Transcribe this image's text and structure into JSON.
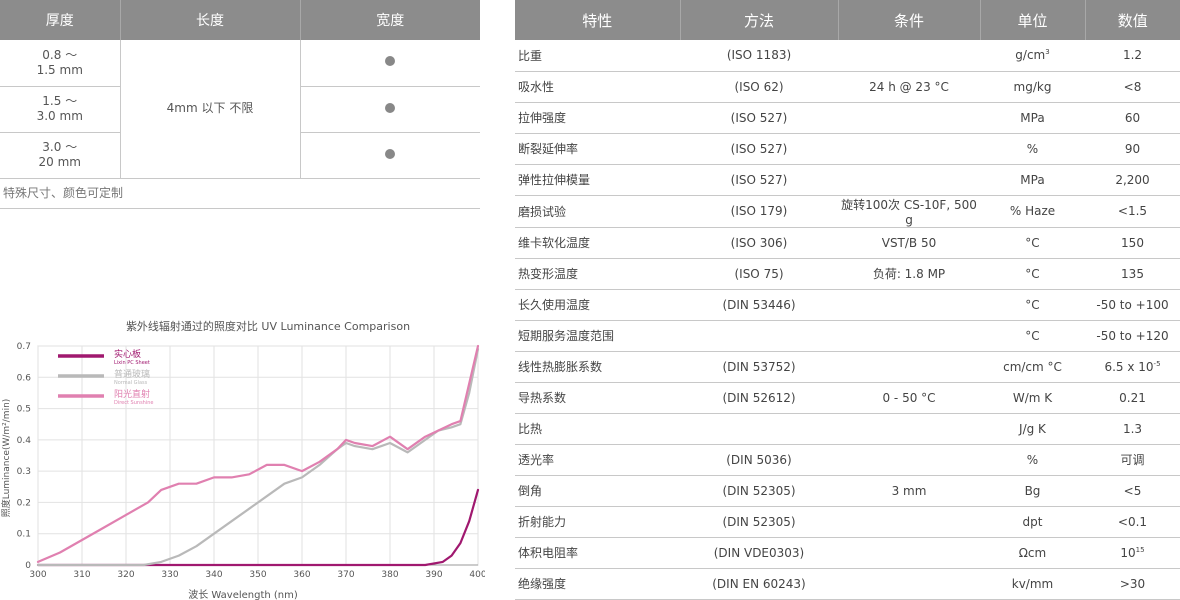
{
  "size_table": {
    "headers": [
      "厚度",
      "长度",
      "宽度"
    ],
    "rows": [
      {
        "thickness_1": "0.8 ～",
        "thickness_2": "1.5 mm"
      },
      {
        "thickness_1": "1.5 ～",
        "thickness_2": "3.0 mm"
      },
      {
        "thickness_1": "3.0 ～",
        "thickness_2": "20 mm"
      }
    ],
    "length_value": "4mm 以下 不限",
    "note": "特殊尺寸、颜色可定制"
  },
  "chart_data": {
    "type": "line",
    "title": "紫外线辐射通过的照度对比 UV Luminance Comparison",
    "xlabel": "波长 Wavelength (nm)",
    "ylabel": "照度Luminance(W/m²/min)",
    "xlim": [
      300,
      400
    ],
    "ylim": [
      0,
      0.7
    ],
    "x_ticks": [
      "300",
      "310",
      "320",
      "330",
      "340",
      "350",
      "360",
      "370",
      "380",
      "390",
      "400"
    ],
    "y_ticks": [
      "0",
      "0.1",
      "0.2",
      "0.3",
      "0.4",
      "0.5",
      "0.6",
      "0.7"
    ],
    "grid": true,
    "legend_placement": "top-left",
    "series": [
      {
        "name": "实心板",
        "sub": "Lixin PC Sheet",
        "color": "#a0186f",
        "x": [
          300,
          350,
          388,
          392,
          394,
          396,
          398,
          400
        ],
        "y": [
          0,
          0,
          0,
          0.01,
          0.03,
          0.07,
          0.14,
          0.24
        ]
      },
      {
        "name": "普通玻璃",
        "sub": "Normal Glass",
        "color": "#b9b9b9",
        "x": [
          300,
          324,
          328,
          332,
          336,
          340,
          344,
          348,
          352,
          356,
          360,
          364,
          368,
          370,
          372,
          376,
          380,
          384,
          388,
          391,
          394,
          396,
          398,
          400
        ],
        "y": [
          0,
          0,
          0.01,
          0.03,
          0.06,
          0.1,
          0.14,
          0.18,
          0.22,
          0.26,
          0.28,
          0.32,
          0.37,
          0.39,
          0.38,
          0.37,
          0.39,
          0.36,
          0.4,
          0.43,
          0.44,
          0.45,
          0.55,
          0.69
        ]
      },
      {
        "name": "阳光直射",
        "sub": "Direct Sunshine",
        "color": "#e080b0",
        "x": [
          300,
          305,
          310,
          315,
          320,
          325,
          328,
          332,
          336,
          340,
          344,
          348,
          352,
          356,
          360,
          364,
          368,
          370,
          372,
          376,
          380,
          384,
          388,
          391,
          394,
          396,
          398,
          400
        ],
        "y": [
          0.01,
          0.04,
          0.08,
          0.12,
          0.16,
          0.2,
          0.24,
          0.26,
          0.26,
          0.28,
          0.28,
          0.29,
          0.32,
          0.32,
          0.3,
          0.33,
          0.37,
          0.4,
          0.39,
          0.38,
          0.41,
          0.37,
          0.41,
          0.43,
          0.45,
          0.46,
          0.58,
          0.7
        ]
      }
    ]
  },
  "prop_table": {
    "headers": [
      "特性",
      "方法",
      "条件",
      "单位",
      "数值"
    ],
    "rows": [
      {
        "prop": "比重",
        "method": "(ISO 1183)",
        "cond": "",
        "unit": "g/cm",
        "unit_sup": "3",
        "val": "1.2"
      },
      {
        "prop": "吸水性",
        "method": "(ISO 62)",
        "cond": "24 h @ 23 °C",
        "unit": "mg/kg",
        "val": "<8"
      },
      {
        "prop": "拉伸强度",
        "method": "(ISO 527)",
        "cond": "",
        "unit": "MPa",
        "val": "60"
      },
      {
        "prop": "断裂延伸率",
        "method": "(ISO 527)",
        "cond": "",
        "unit": "%",
        "val": "90"
      },
      {
        "prop": "弹性拉伸模量",
        "method": "(ISO 527)",
        "cond": "",
        "unit": "MPa",
        "val": "2,200"
      },
      {
        "prop": "磨损试验",
        "method": "(ISO 179)",
        "cond": "旋转100次 CS-10F, 500 g",
        "unit": "% Haze",
        "val": "<1.5"
      },
      {
        "prop": "维卡软化温度",
        "method": "(ISO 306)",
        "cond": "VST/B 50",
        "unit": "°C",
        "val": "150"
      },
      {
        "prop": "热变形温度",
        "method": "(ISO 75)",
        "cond": "负荷: 1.8 MP",
        "unit": "°C",
        "val": "135"
      },
      {
        "prop": "长久使用温度",
        "method": "(DIN 53446)",
        "cond": "",
        "unit": "°C",
        "val": "-50 to +100"
      },
      {
        "prop": "短期服务温度范围",
        "method": "",
        "cond": "",
        "unit": "°C",
        "val": "-50 to +120"
      },
      {
        "prop": "线性热膨胀系数",
        "method": "(DIN 53752)",
        "cond": "",
        "unit": "cm/cm °C",
        "val": "6.5 x 10",
        "val_sup": "-5"
      },
      {
        "prop": "导热系数",
        "method": "(DIN 52612)",
        "cond": "0 - 50 °C",
        "unit": "W/m K",
        "val": "0.21"
      },
      {
        "prop": "比热",
        "method": "",
        "cond": "",
        "unit": "J/g K",
        "val": "1.3"
      },
      {
        "prop": "透光率",
        "method": "(DIN 5036)",
        "cond": "",
        "unit": "%",
        "val": "可调"
      },
      {
        "prop": "倒角",
        "method": "(DIN 52305)",
        "cond": "3 mm",
        "unit": "Bg",
        "val": "<5"
      },
      {
        "prop": "折射能力",
        "method": "(DIN 52305)",
        "cond": "",
        "unit": "dpt",
        "val": "<0.1"
      },
      {
        "prop": "体积电阻率",
        "method": "(DIN VDE0303)",
        "cond": "",
        "unit": "Ωcm",
        "val": "10",
        "val_sup": "15"
      },
      {
        "prop": "绝缘强度",
        "method": "(DIN EN 60243)",
        "cond": "",
        "unit": "kv/mm",
        "val": ">30"
      }
    ]
  }
}
